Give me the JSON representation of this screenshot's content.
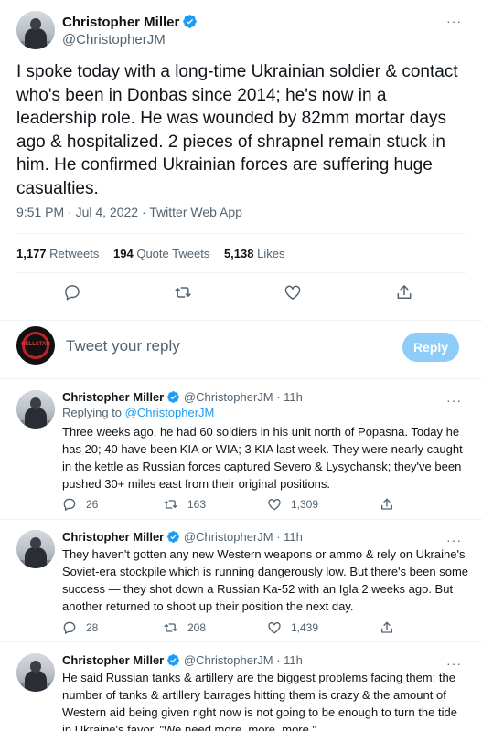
{
  "main_tweet": {
    "author_name": "Christopher Miller",
    "author_handle": "@ChristopherJM",
    "text": "I spoke today with a long-time Ukrainian soldier & contact who's been in Donbas since 2014; he's now in a leadership role. He was wounded by 82mm mortar days ago & hospitalized. 2 pieces of shrapnel remain stuck in him. He confirmed Ukrainian forces are suffering huge casualties.",
    "meta": "9:51 PM · Jul 4, 2022 · Twitter Web App",
    "more_icon": "···",
    "stats": {
      "retweets_count": "1,177",
      "retweets_label": "Retweets",
      "quotes_count": "194",
      "quotes_label": "Quote Tweets",
      "likes_count": "5,138",
      "likes_label": "Likes"
    }
  },
  "reply_composer": {
    "placeholder": "Tweet your reply",
    "button_label": "Reply",
    "avatar_text": "HELLSTAR"
  },
  "replies": [
    {
      "author_name": "Christopher Miller",
      "author_handle": "@ChristopherJM · 11h",
      "replying_prefix": "Replying to ",
      "replying_to": "@ChristopherJM",
      "text": "Three weeks ago, he had 60 soldiers in his unit north of Popasna. Today he has 20; 40 have been KIA or WIA; 3 KIA last week. They were nearly caught in the kettle as Russian forces captured Severo & Lysychansk; they've been pushed 30+ miles east from their original positions.",
      "reply_count": "26",
      "retweet_count": "163",
      "like_count": "1,309"
    },
    {
      "author_name": "Christopher Miller",
      "author_handle": "@ChristopherJM · 11h",
      "text": "They haven't gotten any new Western weapons or ammo & rely on Ukraine's Soviet-era stockpile which is running dangerously low. But there's been some success — they shot down a Russian Ka-52 with an Igla 2 weeks ago. But another returned to shoot up their position the next day.",
      "reply_count": "28",
      "retweet_count": "208",
      "like_count": "1,439"
    },
    {
      "author_name": "Christopher Miller",
      "author_handle": "@ChristopherJM · 11h",
      "text": "He said Russian tanks & artillery are the biggest problems facing them; the number of tanks & artillery barrages hitting them is crazy & the amount of Western aid being given right now is not going to be enough to turn the tide in Ukraine's favor. \"We need more, more, more.\""
    }
  ],
  "colors": {
    "accent": "#1d9bf0",
    "text": "#0f1419",
    "muted": "#536471",
    "divider": "#eff3f4",
    "reply_button_disabled": "#8ecdf8"
  }
}
